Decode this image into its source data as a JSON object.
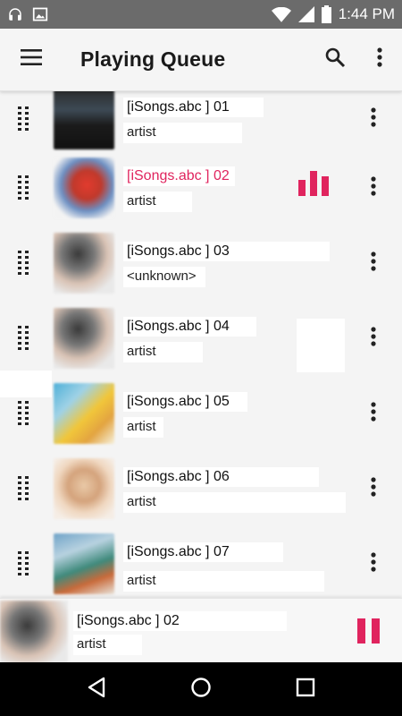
{
  "status_bar": {
    "time": "1:44 PM",
    "icons": [
      "headphones-icon",
      "image-icon",
      "wifi-icon",
      "signal-icon",
      "battery-icon"
    ]
  },
  "app_bar": {
    "title": "Playing Queue",
    "menu_icon": "hamburger-menu-icon",
    "search_icon": "search-icon",
    "more_icon": "more-vert-icon"
  },
  "queue": [
    {
      "title": "[iSongs.abc ] 01",
      "artist": "artist",
      "playing": false
    },
    {
      "title": "[iSongs.abc ] 02",
      "artist": "artist",
      "playing": true
    },
    {
      "title": "[iSongs.abc ] 03",
      "artist": "<unknown>",
      "playing": false
    },
    {
      "title": "[iSongs.abc ] 04",
      "artist": "artist",
      "playing": false
    },
    {
      "title": "[iSongs.abc ] 05",
      "artist": "artist",
      "playing": false
    },
    {
      "title": "[iSongs.abc ] 06",
      "artist": "artist",
      "playing": false
    },
    {
      "title": "[iSongs.abc ] 07",
      "artist": "artist",
      "playing": false
    }
  ],
  "mini_player": {
    "title": "[iSongs.abc ] 02",
    "artist": "artist",
    "state_icon": "pause-icon"
  },
  "nav_bar": {
    "icons": [
      "back-icon",
      "home-icon",
      "recents-icon"
    ]
  },
  "colors": {
    "accent": "#e0245e",
    "status_bar": "#6b6b6b",
    "app_bar": "#f5f5f5",
    "nav_bar": "#000000"
  }
}
